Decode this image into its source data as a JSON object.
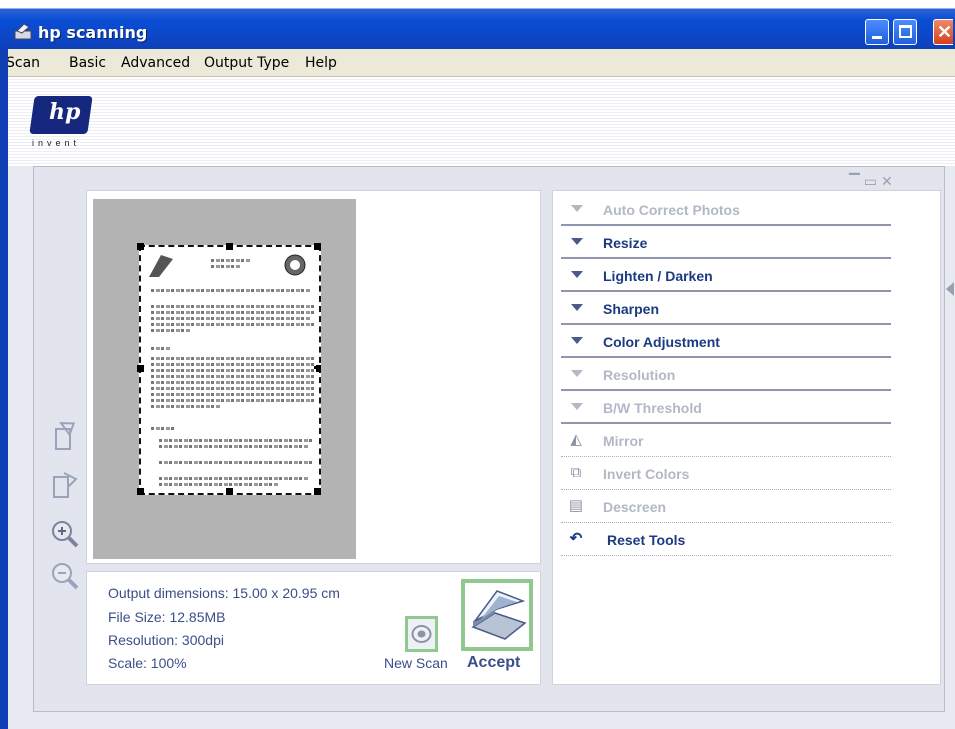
{
  "window": {
    "title": "hp scanning"
  },
  "menu": [
    "Scan",
    "Basic",
    "Advanced",
    "Output Type",
    "Help"
  ],
  "logo": {
    "brand": "hp",
    "tagline": "invent"
  },
  "info": {
    "output_dimensions": "Output dimensions: 15.00 x 20.95 cm",
    "file_size": "File Size: 12.85MB",
    "resolution": "Resolution:  300dpi",
    "scale": "Scale: 100%"
  },
  "actions": {
    "new_scan": "New Scan",
    "accept": "Accept"
  },
  "tools": [
    {
      "label": "Auto Correct Photos",
      "icon": "triangle-down-icon",
      "enabled": false
    },
    {
      "label": "Resize",
      "icon": "triangle-down-icon",
      "enabled": true
    },
    {
      "label": "Lighten / Darken",
      "icon": "triangle-down-icon",
      "enabled": true
    },
    {
      "label": "Sharpen",
      "icon": "triangle-down-icon",
      "enabled": true
    },
    {
      "label": "Color Adjustment",
      "icon": "triangle-down-icon",
      "enabled": true
    },
    {
      "label": "Resolution",
      "icon": "triangle-down-icon",
      "enabled": false
    },
    {
      "label": "B/W Threshold",
      "icon": "triangle-down-icon",
      "enabled": false
    },
    {
      "label": "Mirror",
      "icon": "mirror-icon",
      "enabled": false
    },
    {
      "label": "Invert Colors",
      "icon": "invert-colors-icon",
      "enabled": false
    },
    {
      "label": "Descreen",
      "icon": "descreen-icon",
      "enabled": false
    },
    {
      "label": "Reset Tools",
      "icon": "undo-icon",
      "enabled": true
    }
  ],
  "side_tools": [
    "rotate-left-icon",
    "rotate-right-icon",
    "zoom-in-icon",
    "zoom-out-icon"
  ],
  "colors": {
    "titlebar": "#0a4ed4",
    "accent_text": "#1c3a80",
    "highlight": "#8fc98f",
    "disabled": "#b3b8c6"
  }
}
